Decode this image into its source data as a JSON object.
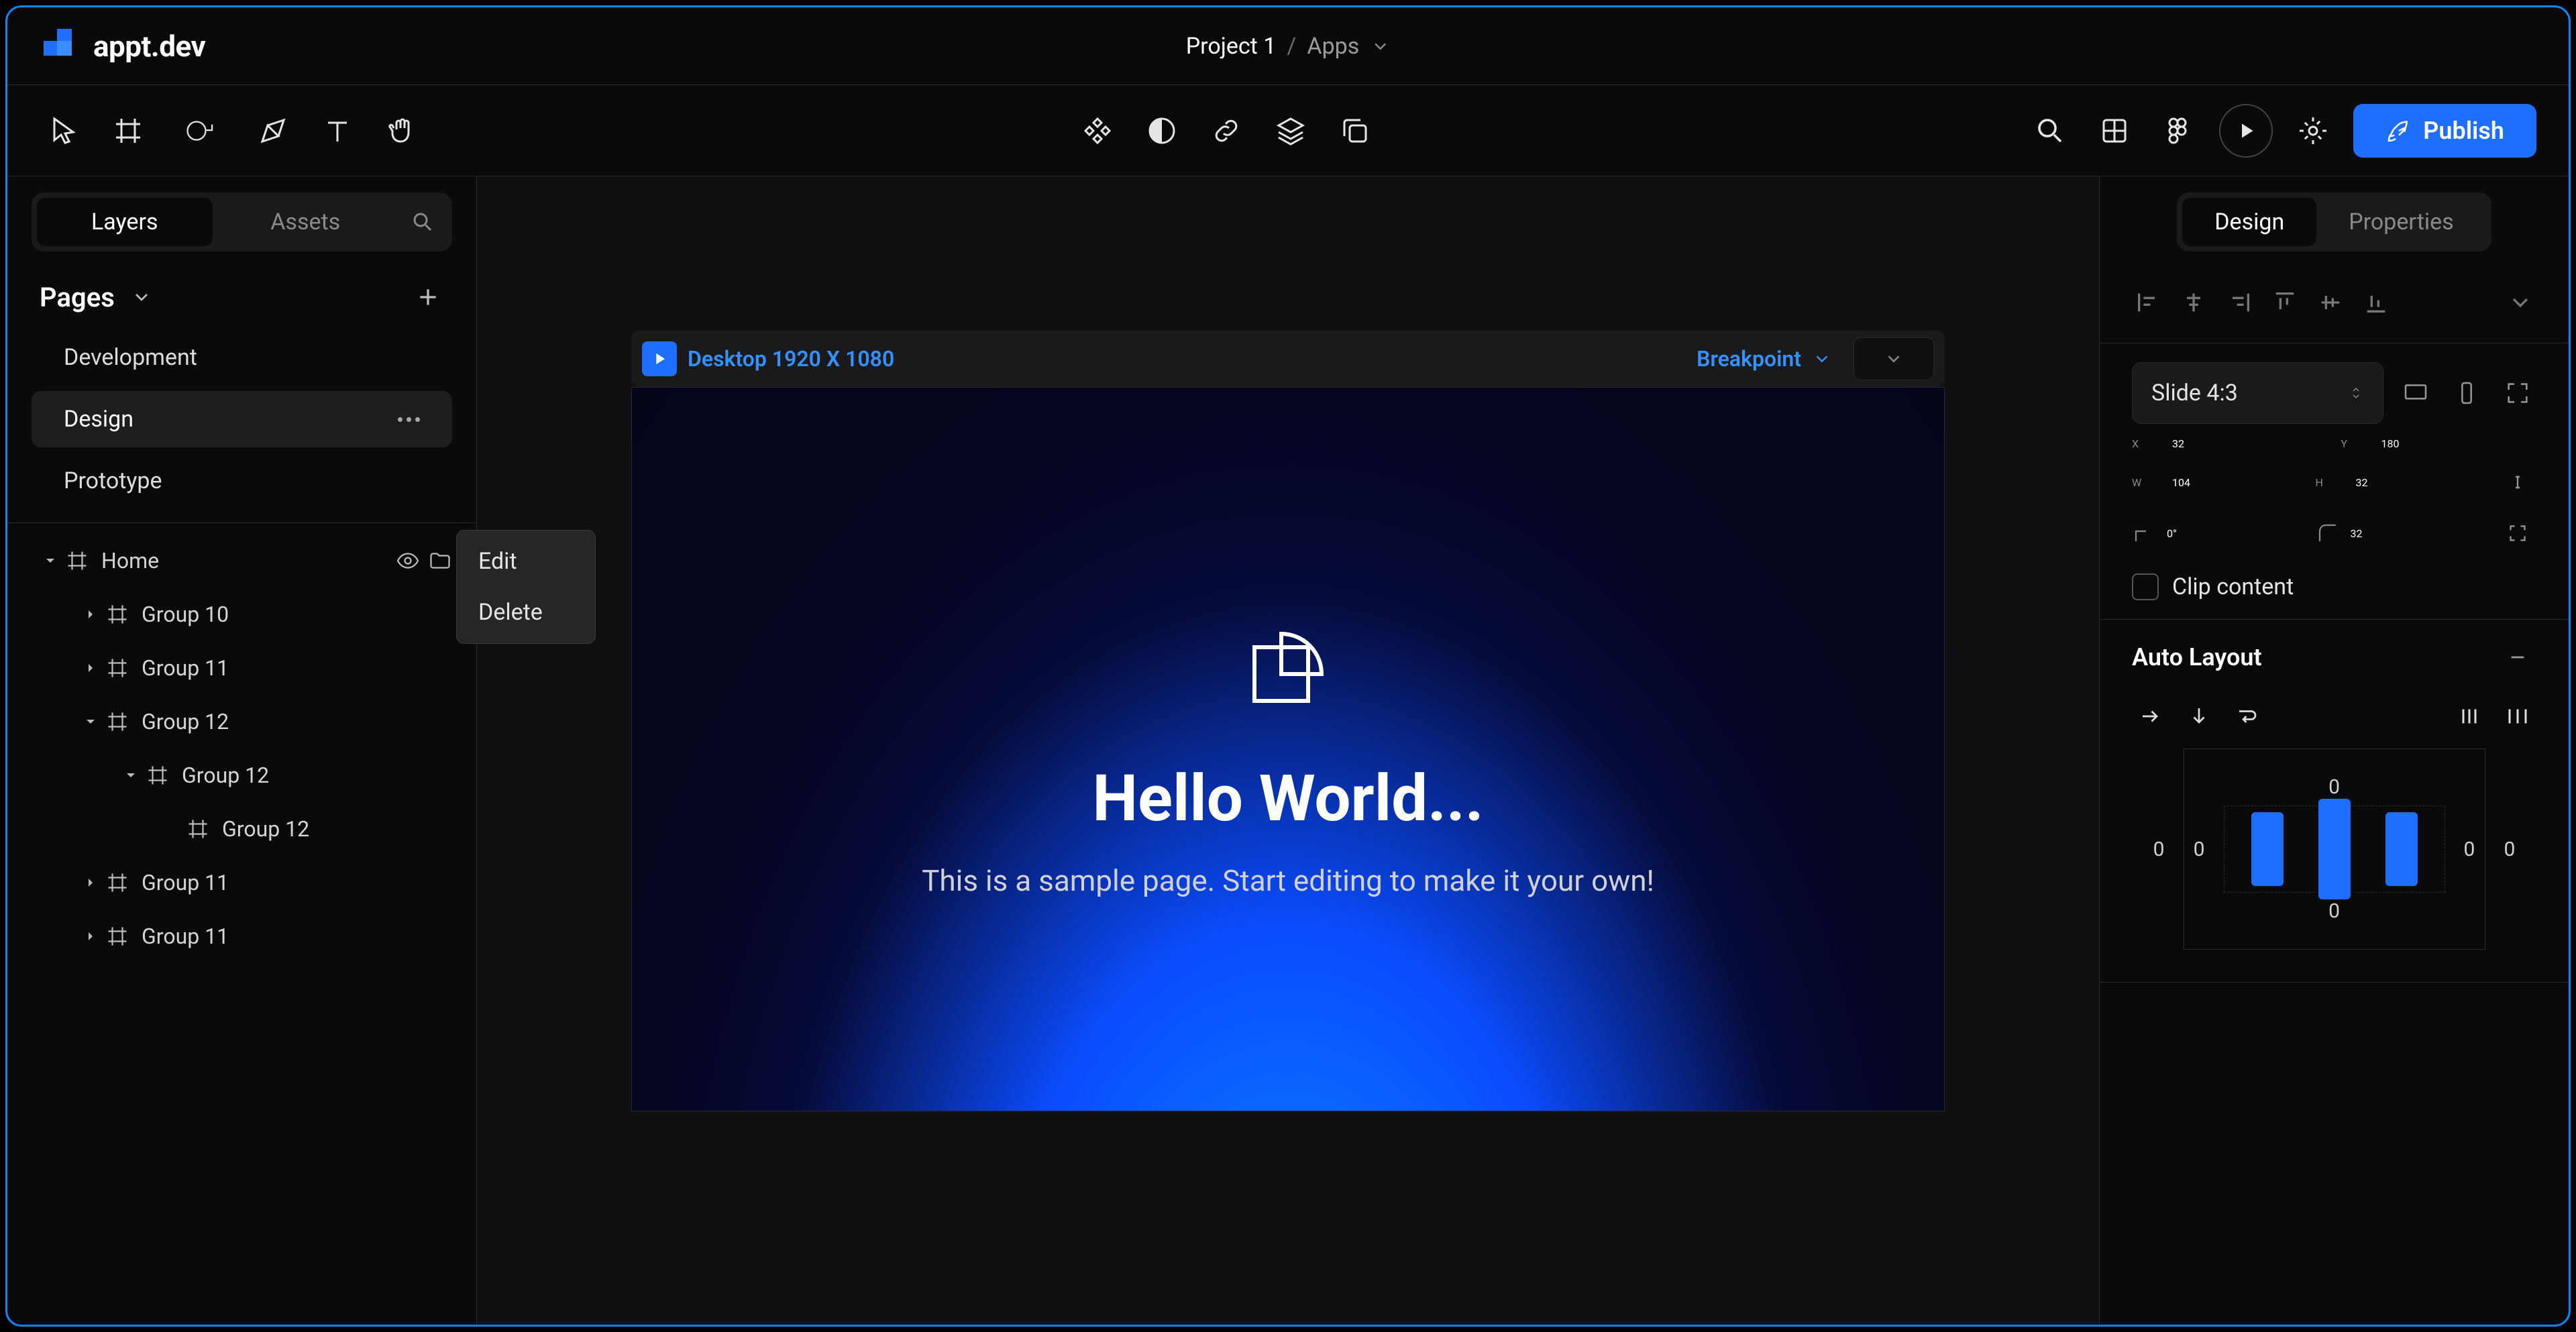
{
  "logo_text": "appt.dev",
  "breadcrumb": {
    "project": "Project 1",
    "sub": "Apps"
  },
  "publish_label": "Publish",
  "tabs": {
    "layers": "Layers",
    "assets": "Assets"
  },
  "pages": {
    "title": "Pages",
    "items": [
      "Development",
      "Design",
      "Prototype"
    ]
  },
  "context_menu": {
    "edit": "Edit",
    "delete": "Delete"
  },
  "layers": {
    "home": "Home",
    "group10": "Group 10",
    "group11a": "Group 11",
    "group12": "Group 12",
    "group12a": "Group 12",
    "group12b": "Group 12",
    "group11b": "Group 11",
    "group11c": "Group 11"
  },
  "frame": {
    "title": "Desktop 1920 X 1080",
    "breakpoint": "Breakpoint"
  },
  "canvas": {
    "hello": "Hello World...",
    "sub": "This is a sample page. Start editing to make it your own!"
  },
  "right_tabs": {
    "design": "Design",
    "properties": "Properties"
  },
  "frame_size": {
    "label": "Slide 4:3"
  },
  "props": {
    "x": {
      "label": "X",
      "value": "32"
    },
    "y": {
      "label": "Y",
      "value": "180"
    },
    "w": {
      "label": "W",
      "value": "104"
    },
    "h": {
      "label": "H",
      "value": "32"
    },
    "rot": {
      "value": "0°"
    },
    "radius": {
      "value": "32"
    },
    "clip": "Clip content"
  },
  "autolayout": {
    "title": "Auto Layout",
    "top": "0",
    "bottom": "0",
    "left": "0",
    "right": "0",
    "gap_left": "0",
    "gap_right": "0"
  }
}
